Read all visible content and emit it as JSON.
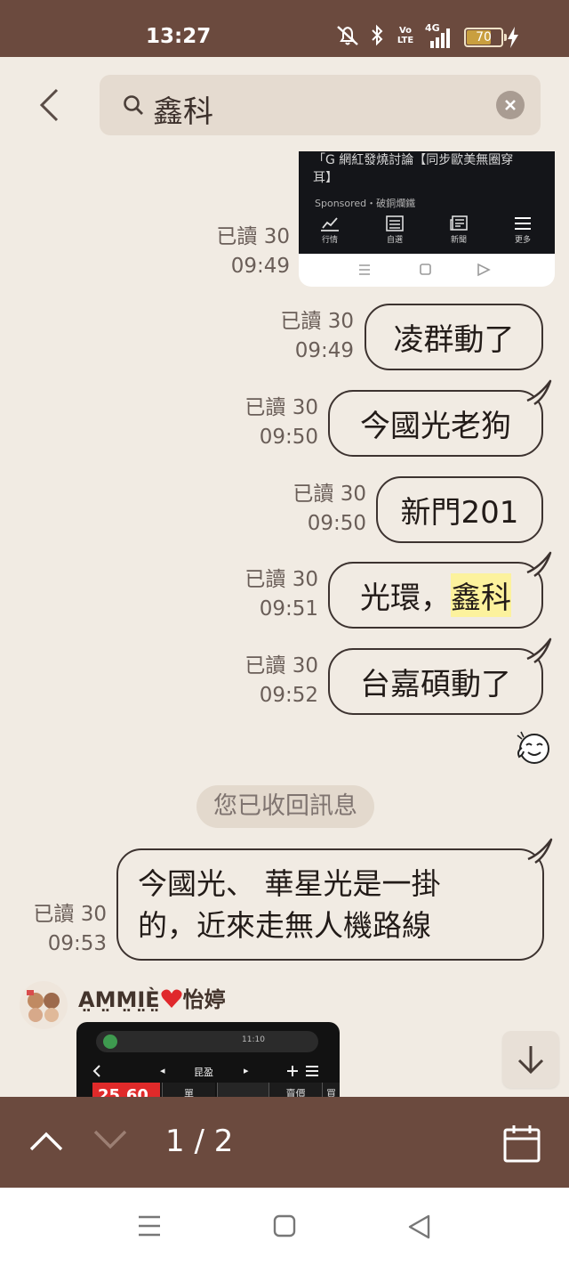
{
  "status": {
    "time": "13:27",
    "volte": "Vo LTE",
    "network": "4G",
    "battery": "70",
    "battery_level": 0.7
  },
  "search": {
    "query": "鑫科"
  },
  "chat": {
    "shared_image": {
      "title_line1": "「G 網紅發燒討論【同步歐美無圈穿",
      "title_line2": "耳】",
      "sponsor": "Sponsored・破銅爛鐵",
      "tabs": [
        "行情",
        "自選",
        "新聞",
        "更多"
      ]
    },
    "messages": [
      {
        "read": "已讀 30",
        "time": "09:49"
      },
      {
        "read": "已讀 30",
        "time": "09:49",
        "parts": [
          {
            "t": "凌群動了"
          }
        ]
      },
      {
        "read": "已讀 30",
        "time": "09:50",
        "parts": [
          {
            "t": "今國光老狗"
          }
        ]
      },
      {
        "read": "已讀 30",
        "time": "09:50",
        "parts": [
          {
            "t": "新門201"
          }
        ]
      },
      {
        "read": "已讀 30",
        "time": "09:51",
        "parts": [
          {
            "t": "光環，"
          },
          {
            "t": "鑫科",
            "hl": true
          }
        ]
      },
      {
        "read": "已讀 30",
        "time": "09:52",
        "parts": [
          {
            "t": "台嘉碩動了"
          }
        ]
      },
      {
        "read": "已讀 30",
        "time": "09:53",
        "lines": [
          "今國光、 華星光是一掛",
          "的，近來走無人機路線"
        ]
      }
    ],
    "recall_notice": "您已收回訊息",
    "sender": {
      "name": "A̤M̤M̤I̤È̤",
      "name_suffix": "怡婷",
      "stock": {
        "clock": "11:10",
        "symbol": "昆盈",
        "price": "25.60",
        "cols": [
          "單",
          "賣價",
          "買出"
        ]
      }
    }
  },
  "search_nav": {
    "counter": "1 / 2"
  }
}
